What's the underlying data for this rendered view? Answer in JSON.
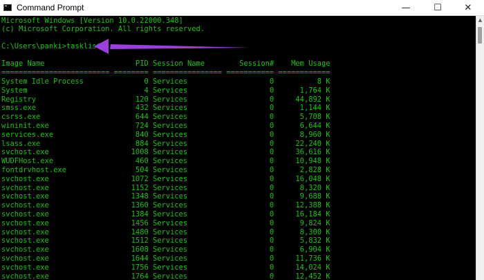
{
  "window": {
    "title": "Command Prompt",
    "controls": {
      "minimize": "—",
      "maximize": "☐",
      "close": "✕"
    }
  },
  "console": {
    "header_lines": [
      "Microsoft Windows [Version 10.0.22000.348]",
      "(c) Microsoft Corporation. All rights reserved."
    ],
    "prompt": "C:\\Users\\panki>",
    "command": "tasklist",
    "columns": {
      "image_name": "Image Name",
      "pid": "PID",
      "session_name": "Session Name",
      "session_num": "Session#",
      "mem_usage": "Mem Usage"
    },
    "separator": "========================= ======== ================ =========== ============",
    "processes": [
      {
        "image": "System Idle Process",
        "pid": "0",
        "session": "Services",
        "num": "0",
        "mem": "8 K"
      },
      {
        "image": "System",
        "pid": "4",
        "session": "Services",
        "num": "0",
        "mem": "1,764 K"
      },
      {
        "image": "Registry",
        "pid": "120",
        "session": "Services",
        "num": "0",
        "mem": "44,892 K"
      },
      {
        "image": "smss.exe",
        "pid": "432",
        "session": "Services",
        "num": "0",
        "mem": "1,144 K"
      },
      {
        "image": "csrss.exe",
        "pid": "644",
        "session": "Services",
        "num": "0",
        "mem": "5,708 K"
      },
      {
        "image": "wininit.exe",
        "pid": "724",
        "session": "Services",
        "num": "0",
        "mem": "6,644 K"
      },
      {
        "image": "services.exe",
        "pid": "840",
        "session": "Services",
        "num": "0",
        "mem": "8,960 K"
      },
      {
        "image": "lsass.exe",
        "pid": "884",
        "session": "Services",
        "num": "0",
        "mem": "22,240 K"
      },
      {
        "image": "svchost.exe",
        "pid": "1008",
        "session": "Services",
        "num": "0",
        "mem": "36,616 K"
      },
      {
        "image": "WUDFHost.exe",
        "pid": "460",
        "session": "Services",
        "num": "0",
        "mem": "10,948 K"
      },
      {
        "image": "fontdrvhost.exe",
        "pid": "504",
        "session": "Services",
        "num": "0",
        "mem": "2,828 K"
      },
      {
        "image": "svchost.exe",
        "pid": "1072",
        "session": "Services",
        "num": "0",
        "mem": "16,048 K"
      },
      {
        "image": "svchost.exe",
        "pid": "1152",
        "session": "Services",
        "num": "0",
        "mem": "8,320 K"
      },
      {
        "image": "svchost.exe",
        "pid": "1348",
        "session": "Services",
        "num": "0",
        "mem": "9,688 K"
      },
      {
        "image": "svchost.exe",
        "pid": "1360",
        "session": "Services",
        "num": "0",
        "mem": "12,388 K"
      },
      {
        "image": "svchost.exe",
        "pid": "1384",
        "session": "Services",
        "num": "0",
        "mem": "16,184 K"
      },
      {
        "image": "svchost.exe",
        "pid": "1456",
        "session": "Services",
        "num": "0",
        "mem": "9,824 K"
      },
      {
        "image": "svchost.exe",
        "pid": "1480",
        "session": "Services",
        "num": "0",
        "mem": "8,300 K"
      },
      {
        "image": "svchost.exe",
        "pid": "1512",
        "session": "Services",
        "num": "0",
        "mem": "5,832 K"
      },
      {
        "image": "svchost.exe",
        "pid": "1608",
        "session": "Services",
        "num": "0",
        "mem": "6,904 K"
      },
      {
        "image": "svchost.exe",
        "pid": "1644",
        "session": "Services",
        "num": "0",
        "mem": "11,736 K"
      },
      {
        "image": "svchost.exe",
        "pid": "1756",
        "session": "Services",
        "num": "0",
        "mem": "14,024 K"
      },
      {
        "image": "svchost.exe",
        "pid": "1764",
        "session": "Services",
        "num": "0",
        "mem": "12,452 K"
      }
    ]
  },
  "colors": {
    "terminal_text": "#16c60c",
    "terminal_background": "#000000",
    "annotation_arrow": "#9b3fe0"
  }
}
